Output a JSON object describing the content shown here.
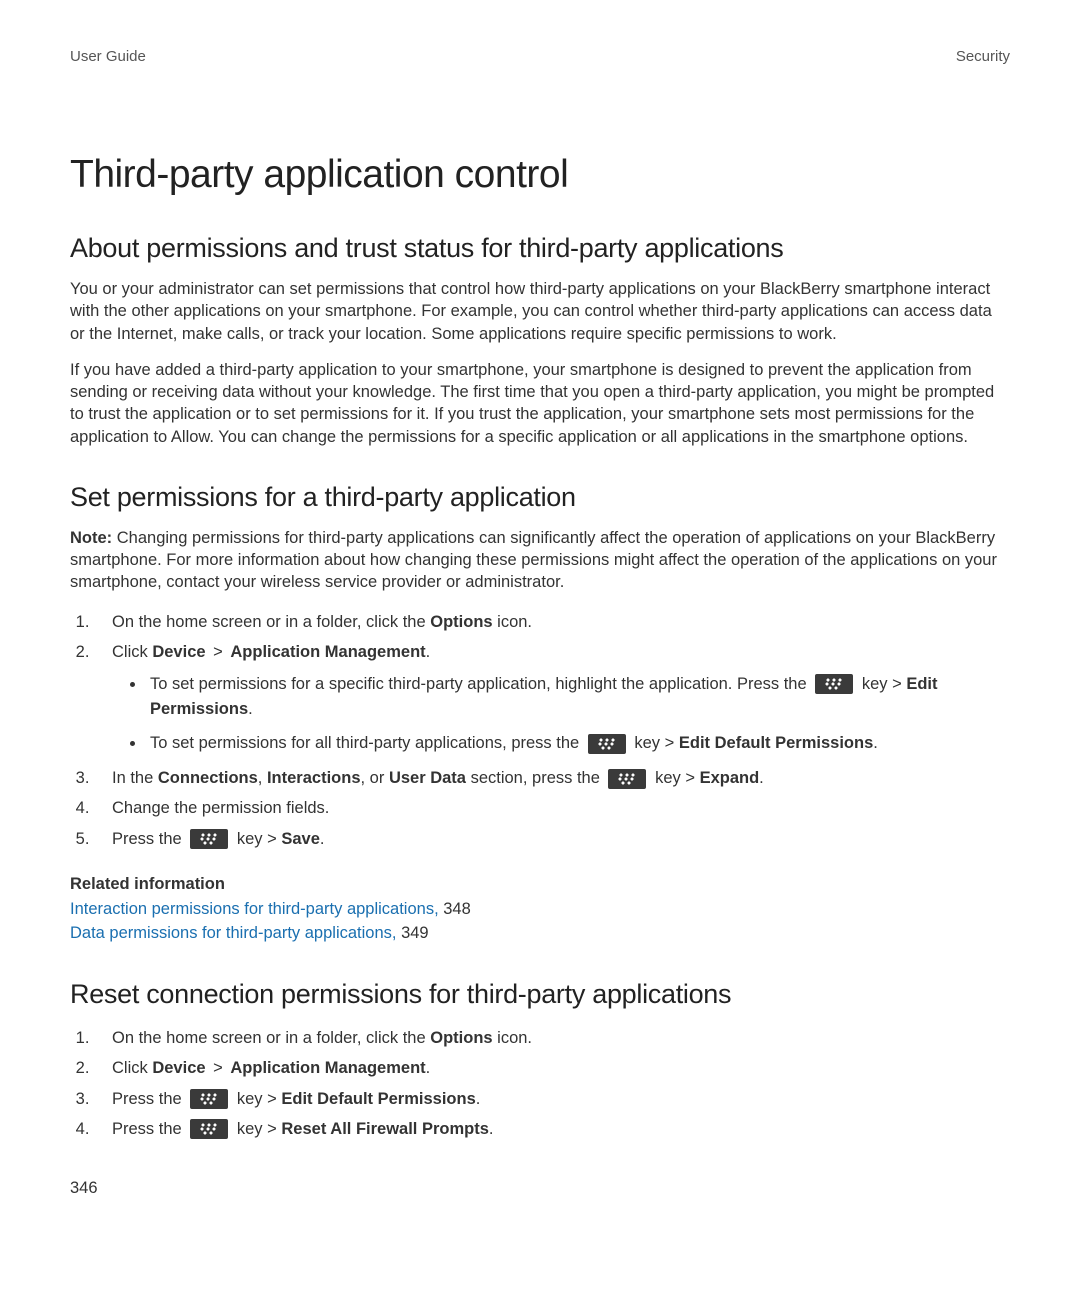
{
  "header": {
    "left": "User Guide",
    "right": "Security"
  },
  "h1": "Third-party application control",
  "sectionA": {
    "title": "About permissions and trust status for third-party applications",
    "p1": "You or your administrator can set permissions that control how third-party applications on your BlackBerry smartphone interact with the other applications on your smartphone. For example, you can control whether third-party applications can access data or the Internet, make calls, or track your location. Some applications require specific permissions to work.",
    "p2": "If you have added a third-party application to your smartphone, your smartphone is designed to prevent the application from sending or receiving data without your knowledge. The first time that you open a third-party application, you might be prompted to trust the application or to set permissions for it. If you trust the application, your smartphone sets most permissions for the application to Allow. You can change the permissions for a specific application or all applications in the smartphone options."
  },
  "sectionB": {
    "title": "Set permissions for a third-party application",
    "noteLabel": "Note:",
    "noteText": " Changing permissions for third-party applications can significantly affect the operation of applications on your BlackBerry smartphone. For more information about how changing these permissions might affect the operation of the applications on your smartphone, contact your wireless service provider or administrator.",
    "step1_a": "On the home screen or in a folder, click the ",
    "step1_b": "Options",
    "step1_c": " icon.",
    "step2_a": "Click ",
    "step2_b": "Device",
    "step2_gt": " > ",
    "step2_c": "Application Management",
    "step2_d": ".",
    "bullet1_a": "To set permissions for a specific third-party application, highlight the application. Press the ",
    "bullet1_key": " key > ",
    "bullet1_b": "Edit Permissions",
    "bullet1_c": ".",
    "bullet2_a": "To set permissions for all third-party applications, press the ",
    "bullet2_key": " key > ",
    "bullet2_b": "Edit Default Permissions",
    "bullet2_c": ".",
    "step3_a": "In the ",
    "step3_b": "Connections",
    "step3_c": ", ",
    "step3_d": "Interactions",
    "step3_e": ", or ",
    "step3_f": "User Data",
    "step3_g": " section, press the ",
    "step3_key": " key > ",
    "step3_h": "Expand",
    "step3_i": ".",
    "step4": "Change the permission fields.",
    "step5_a": "Press the ",
    "step5_key": " key > ",
    "step5_b": "Save",
    "step5_c": "."
  },
  "related": {
    "heading": "Related information",
    "link1": "Interaction permissions for third-party applications, ",
    "page1": "348",
    "link2": "Data permissions for third-party applications, ",
    "page2": "349"
  },
  "sectionC": {
    "title": "Reset connection permissions for third-party applications",
    "step1_a": "On the home screen or in a folder, click the ",
    "step1_b": "Options",
    "step1_c": " icon.",
    "step2_a": "Click ",
    "step2_b": "Device",
    "step2_gt": " > ",
    "step2_c": "Application Management",
    "step2_d": ".",
    "step3_a": "Press the ",
    "step3_key": " key > ",
    "step3_b": "Edit Default Permissions",
    "step3_c": ".",
    "step4_a": "Press the ",
    "step4_key": " key > ",
    "step4_b": "Reset All Firewall Prompts",
    "step4_c": "."
  },
  "pageNumber": "346"
}
